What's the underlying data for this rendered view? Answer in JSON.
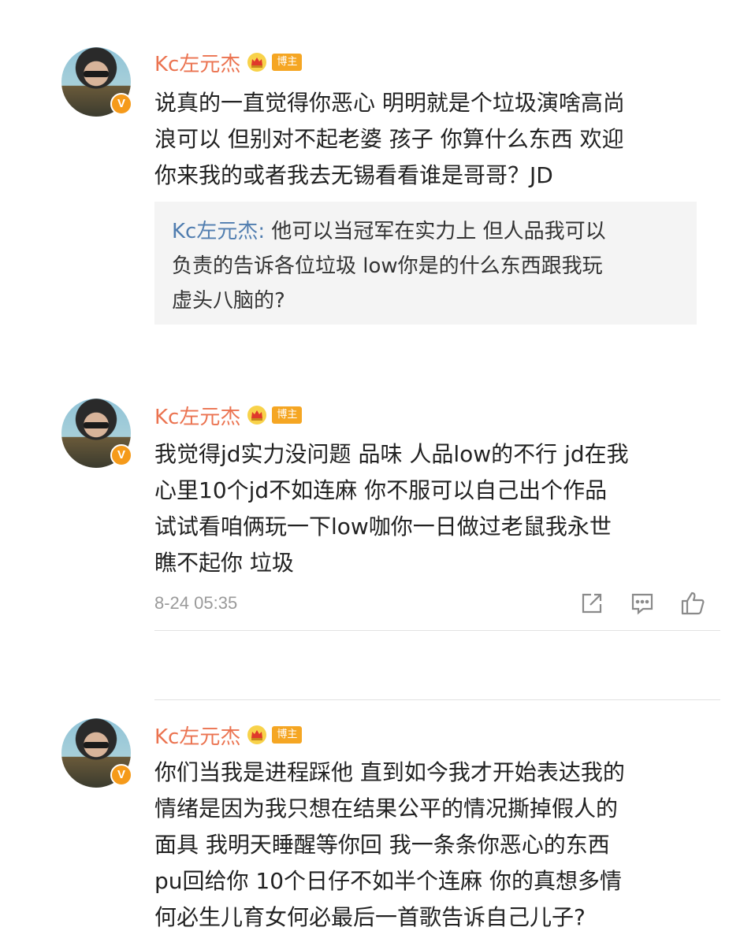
{
  "posts": [
    {
      "username": "Kc左元杰",
      "badge": "博主",
      "verified_mark": "V",
      "text": "说真的一直觉得你恶心 明明就是个垃圾演啥高尚\n浪可以 但别对不起老婆 孩子 你算什么东西 欢迎\n你来我的或者我去无锡看看谁是哥哥？JD",
      "quote": {
        "name": "Kc左元杰:",
        "text": "他可以当冠军在实力上 但人品我可以\n负责的告诉各位垃圾 low你是的什么东西跟我玩\n虚头八脑的?"
      }
    },
    {
      "username": "Kc左元杰",
      "badge": "博主",
      "verified_mark": "V",
      "text": "我觉得jd实力没问题 品味 人品low的不行 jd在我\n心里10个jd不如连麻 你不服可以自己出个作品\n试试看咱俩玩一下low咖你一日做过老鼠我永世\n瞧不起你 垃圾",
      "timestamp": "8-24 05:35",
      "icons": [
        "share-icon",
        "comment-icon",
        "like-icon"
      ]
    },
    {
      "username": "Kc左元杰",
      "badge": "博主",
      "verified_mark": "V",
      "text": "你们当我是进程踩他 直到如今我才开始表达我的\n情绪是因为我只想在结果公平的情况撕掉假人的\n面具 我明天睡醒等你回 我一条条你恶心的东西\npu回给你 10个日仔不如半个连麻 你的真想多情\n何必生儿育女何必最后一首歌告诉自己儿子?"
    }
  ],
  "colors": {
    "username": "#eb7350",
    "quote_name": "#507daf",
    "badge": "#f5a623",
    "verified": "#f59a1a",
    "quote_bg": "#f4f4f4",
    "timestamp": "#9a9a9a"
  }
}
